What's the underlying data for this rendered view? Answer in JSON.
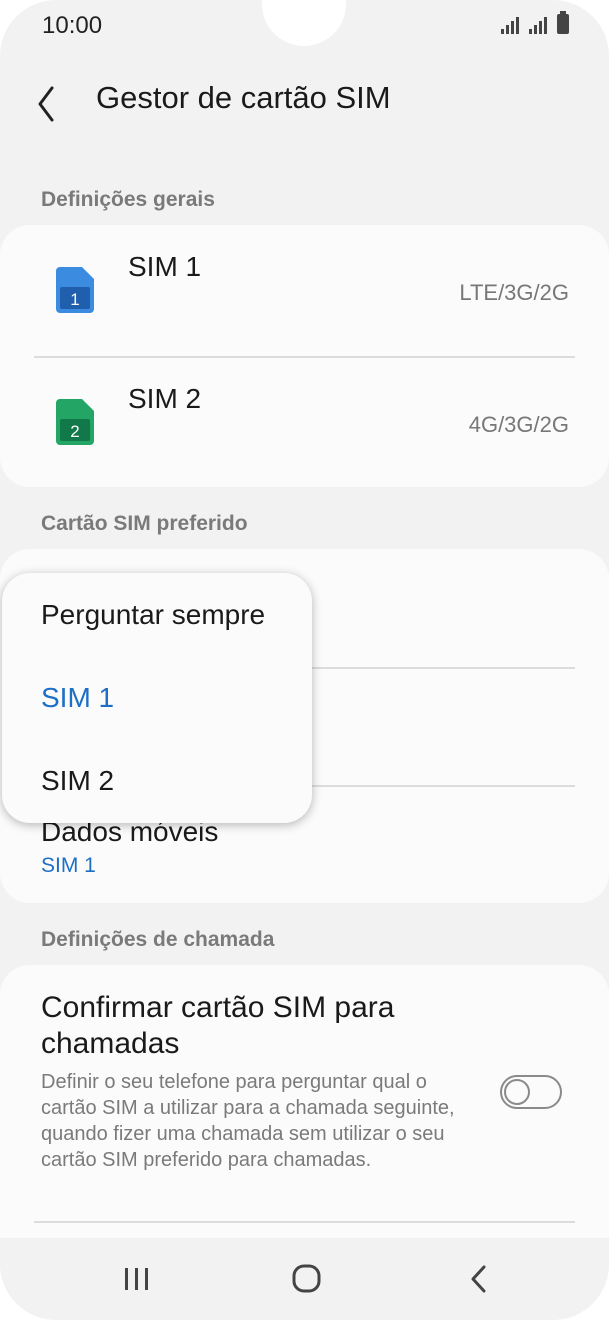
{
  "status_bar": {
    "time": "10:00"
  },
  "app_bar": {
    "title": "Gestor de cartão SIM"
  },
  "sections": {
    "general": "Definições gerais",
    "preferred": "Cartão SIM preferido",
    "call": "Definições de chamada"
  },
  "sims": [
    {
      "name": "SIM 1",
      "network": "LTE/3G/2G",
      "number": "1",
      "color": "#2f7fd6"
    },
    {
      "name": "SIM 2",
      "network": "4G/3G/2G",
      "number": "2",
      "color": "#1e9e5c"
    }
  ],
  "preferred": {
    "mobile_data_label": "Dados móveis",
    "mobile_data_value": "SIM 1"
  },
  "dropdown": {
    "options": [
      {
        "label": "Perguntar sempre",
        "selected": false
      },
      {
        "label": "SIM 1",
        "selected": true
      },
      {
        "label": "SIM 2",
        "selected": false
      }
    ]
  },
  "call_settings": {
    "confirm_title": "Confirmar cartão SIM para chamadas",
    "confirm_desc": "Definir o seu telefone para perguntar qual o cartão SIM a utilizar para a chamada seguinte, quando fizer uma chamada sem utilizar o seu cartão SIM preferido para chamadas.",
    "toggle_on": false
  },
  "colors": {
    "accent": "#1d6fc6",
    "background": "#f2f2f2",
    "card": "#fbfbfb"
  },
  "icons": {
    "back": "chevron-left-icon",
    "nav_recents": "recents-icon",
    "nav_home": "home-icon",
    "nav_back": "back-icon"
  }
}
